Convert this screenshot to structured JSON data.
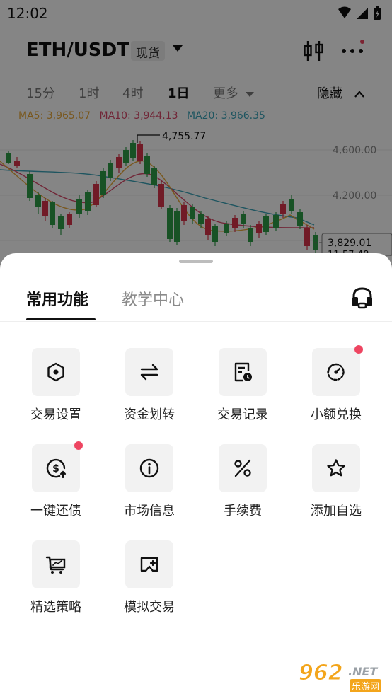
{
  "status_bar": {
    "time": "12:02"
  },
  "header": {
    "pair": "ETH/USDT",
    "market_type": "现货"
  },
  "intervals": {
    "tabs": [
      {
        "label": "15分",
        "active": false
      },
      {
        "label": "1时",
        "active": false
      },
      {
        "label": "4时",
        "active": false
      },
      {
        "label": "1日",
        "active": true
      },
      {
        "label": "更多",
        "active": false
      }
    ],
    "hide_label": "隐藏"
  },
  "ma": {
    "ma5": {
      "label": "MA5: 3,965.07",
      "color": "#e8a838"
    },
    "ma10": {
      "label": "MA10: 3,944.13",
      "color": "#d84a6a"
    },
    "ma20": {
      "label": "MA20: 3,966.35",
      "color": "#3aa3b8"
    }
  },
  "chart_data": {
    "type": "candlestick",
    "price_labels": [
      "4,600.00",
      "4,200.00"
    ],
    "high_label": "4,755.77",
    "current_price": "3,829.01",
    "countdown": "11:57:48",
    "colors": {
      "up": "#2e9e48",
      "down": "#d8344c"
    }
  },
  "sheet": {
    "tabs": [
      {
        "label": "常用功能",
        "active": true
      },
      {
        "label": "教学中心",
        "active": false
      }
    ],
    "functions": [
      {
        "label": "交易设置",
        "icon": "hexagon-settings-icon",
        "badge": false
      },
      {
        "label": "资金划转",
        "icon": "transfer-arrows-icon",
        "badge": false
      },
      {
        "label": "交易记录",
        "icon": "record-clock-icon",
        "badge": false
      },
      {
        "label": "小额兑换",
        "icon": "small-exchange-icon",
        "badge": true
      },
      {
        "label": "一键还债",
        "icon": "repay-dollar-icon",
        "badge": true
      },
      {
        "label": "市场信息",
        "icon": "info-icon",
        "badge": false
      },
      {
        "label": "手续费",
        "icon": "percent-icon",
        "badge": false
      },
      {
        "label": "添加自选",
        "icon": "star-icon",
        "badge": false
      },
      {
        "label": "精选策略",
        "icon": "strategy-cart-icon",
        "badge": false
      },
      {
        "label": "模拟交易",
        "icon": "demo-trade-icon",
        "badge": false
      }
    ]
  },
  "watermark": {
    "number": "962",
    "suffix": ".NET",
    "text": "乐游网"
  }
}
